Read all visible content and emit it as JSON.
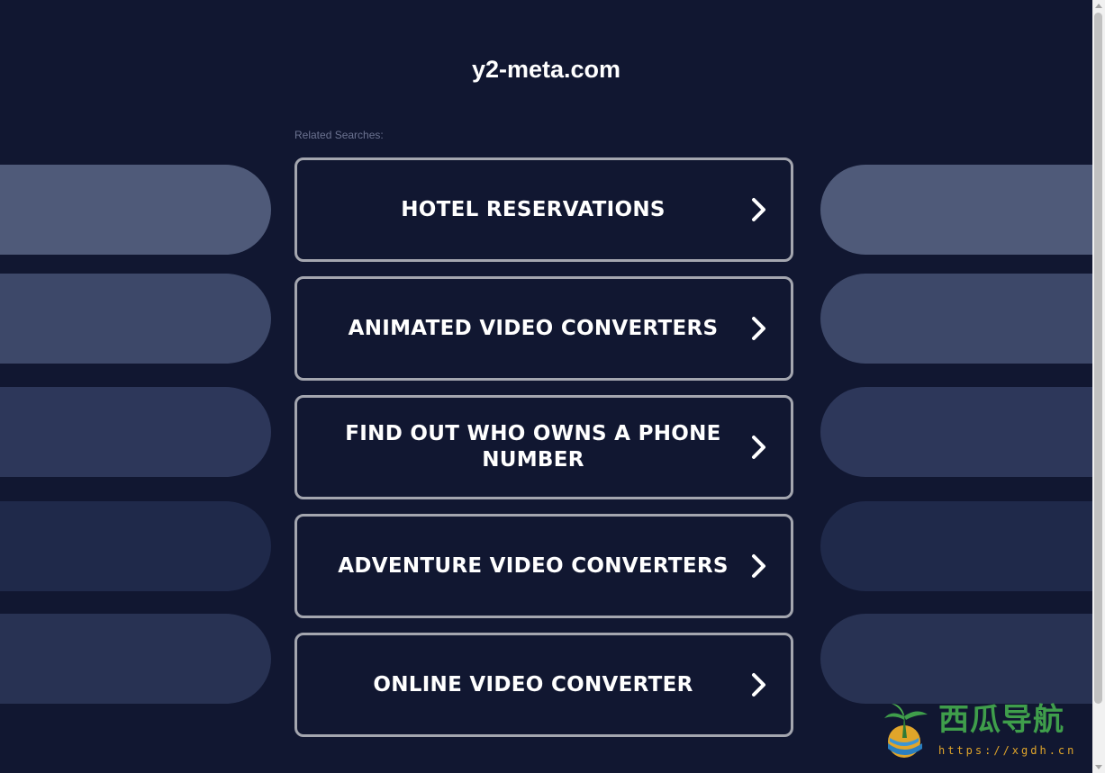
{
  "page": {
    "site_title": "y2-meta.com",
    "related_label": "Related Searches:"
  },
  "searches": [
    {
      "label": "HOTEL RESERVATIONS"
    },
    {
      "label": "ANIMATED VIDEO CONVERTERS"
    },
    {
      "label": "FIND OUT WHO OWNS A PHONE NUMBER"
    },
    {
      "label": "ADVENTURE VIDEO CONVERTERS"
    },
    {
      "label": "ONLINE VIDEO CONVERTER"
    }
  ],
  "icons": {
    "button_icon": "chevron-right-icon"
  },
  "colors": {
    "background": "#111731",
    "button_border": "#a4a6af",
    "text": "#ffffff",
    "label": "#6c7391"
  },
  "watermark": {
    "text": "西瓜导航",
    "url": "https://xgdh.cn"
  }
}
